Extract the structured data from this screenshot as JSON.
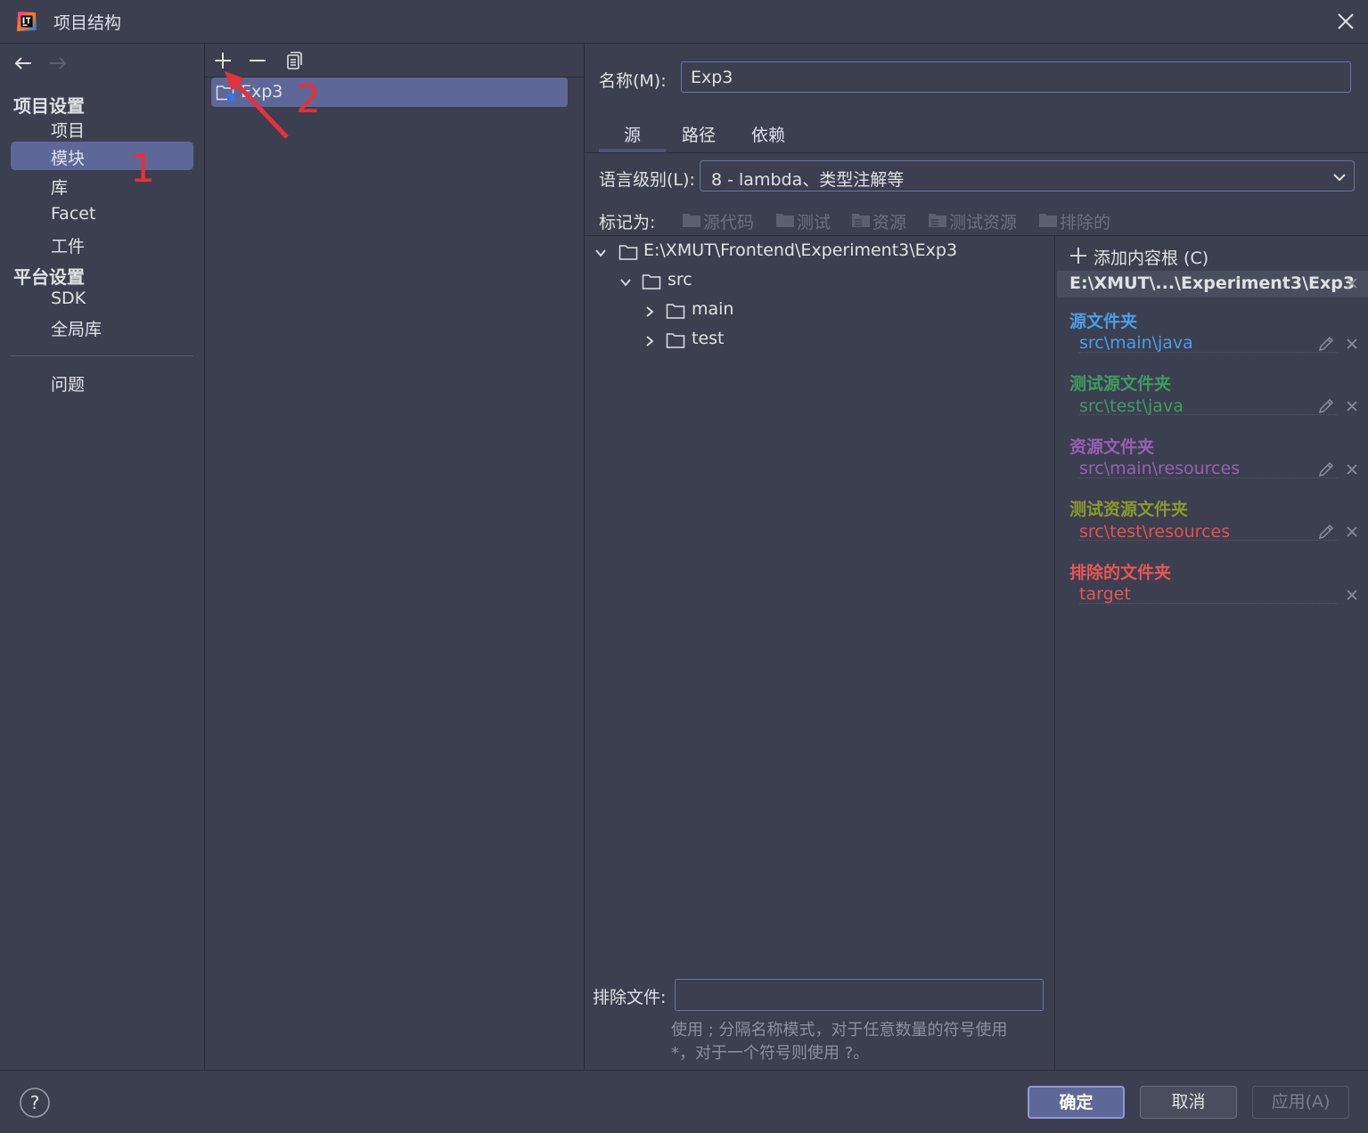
{
  "window": {
    "title": "项目结构",
    "close_icon": "close-icon",
    "app_icon": "intellij-idea-icon"
  },
  "nav": {
    "back_icon": "arrow-left-icon",
    "forward_icon": "arrow-right-icon"
  },
  "sidebar": {
    "project_settings_header": "项目设置",
    "items": [
      {
        "label": "项目"
      },
      {
        "label": "模块",
        "selected": true
      },
      {
        "label": "库"
      },
      {
        "label": "Facet"
      },
      {
        "label": "工件"
      }
    ],
    "platform_settings_header": "平台设置",
    "platform_items": [
      {
        "label": "SDK"
      },
      {
        "label": "全局库"
      }
    ],
    "problems_label": "问题"
  },
  "modules": {
    "toolbar": {
      "add_icon": "plus-icon",
      "remove_icon": "minus-icon",
      "copy_icon": "copy-icon"
    },
    "list": [
      {
        "name": "Exp3",
        "icon": "module-folder-icon"
      }
    ]
  },
  "annotations": {
    "step1": "1",
    "step2": "2",
    "color": "#e8303a"
  },
  "detail": {
    "name_label": "名称(M):",
    "name_value": "Exp3",
    "tabs": [
      "源",
      "路径",
      "依赖"
    ],
    "active_tab": "源",
    "language_level_label": "语言级别(L):",
    "language_level_value": "8 - lambda、类型注解等",
    "mark_as_label": "标记为:",
    "mark_as_options": [
      "源代码",
      "测试",
      "资源",
      "测试资源",
      "排除的"
    ],
    "tree": [
      {
        "label": "E:\\XMUT\\Frontend\\Experiment3\\Exp3",
        "expanded": true
      },
      {
        "label": "src",
        "expanded": true
      },
      {
        "label": "main",
        "expanded": false
      },
      {
        "label": "test",
        "expanded": false
      }
    ],
    "exclude_files_label": "排除文件:",
    "exclude_files_value": "",
    "exclude_hint_line1": "使用 ; 分隔名称模式，对于任意数量的符号使用",
    "exclude_hint_line2": "*，对于一个符号则使用 ?。"
  },
  "content_roots": {
    "add_label": "添加内容根 (C)",
    "root_path": "E:\\XMUT\\...\\Experiment3\\Exp3",
    "categories": [
      {
        "title": "源文件夹",
        "path": "src\\main\\java",
        "color": "#4a9eea",
        "editable": true
      },
      {
        "title": "测试源文件夹",
        "path": "src\\test\\java",
        "color": "#3e9c5e",
        "editable": true
      },
      {
        "title": "资源文件夹",
        "path": "src\\main\\resources",
        "color": "#9660b0",
        "editable": true
      },
      {
        "title": "测试资源文件夹",
        "path": "src\\test\\resources",
        "color": "#8a9a2c",
        "path_color": "#e8504a",
        "editable": true
      },
      {
        "title": "排除的文件夹",
        "path": "target",
        "color": "#e85656",
        "editable": false
      }
    ]
  },
  "footer": {
    "help_icon": "question-icon",
    "ok": "确定",
    "cancel": "取消",
    "apply": "应用(A)"
  }
}
